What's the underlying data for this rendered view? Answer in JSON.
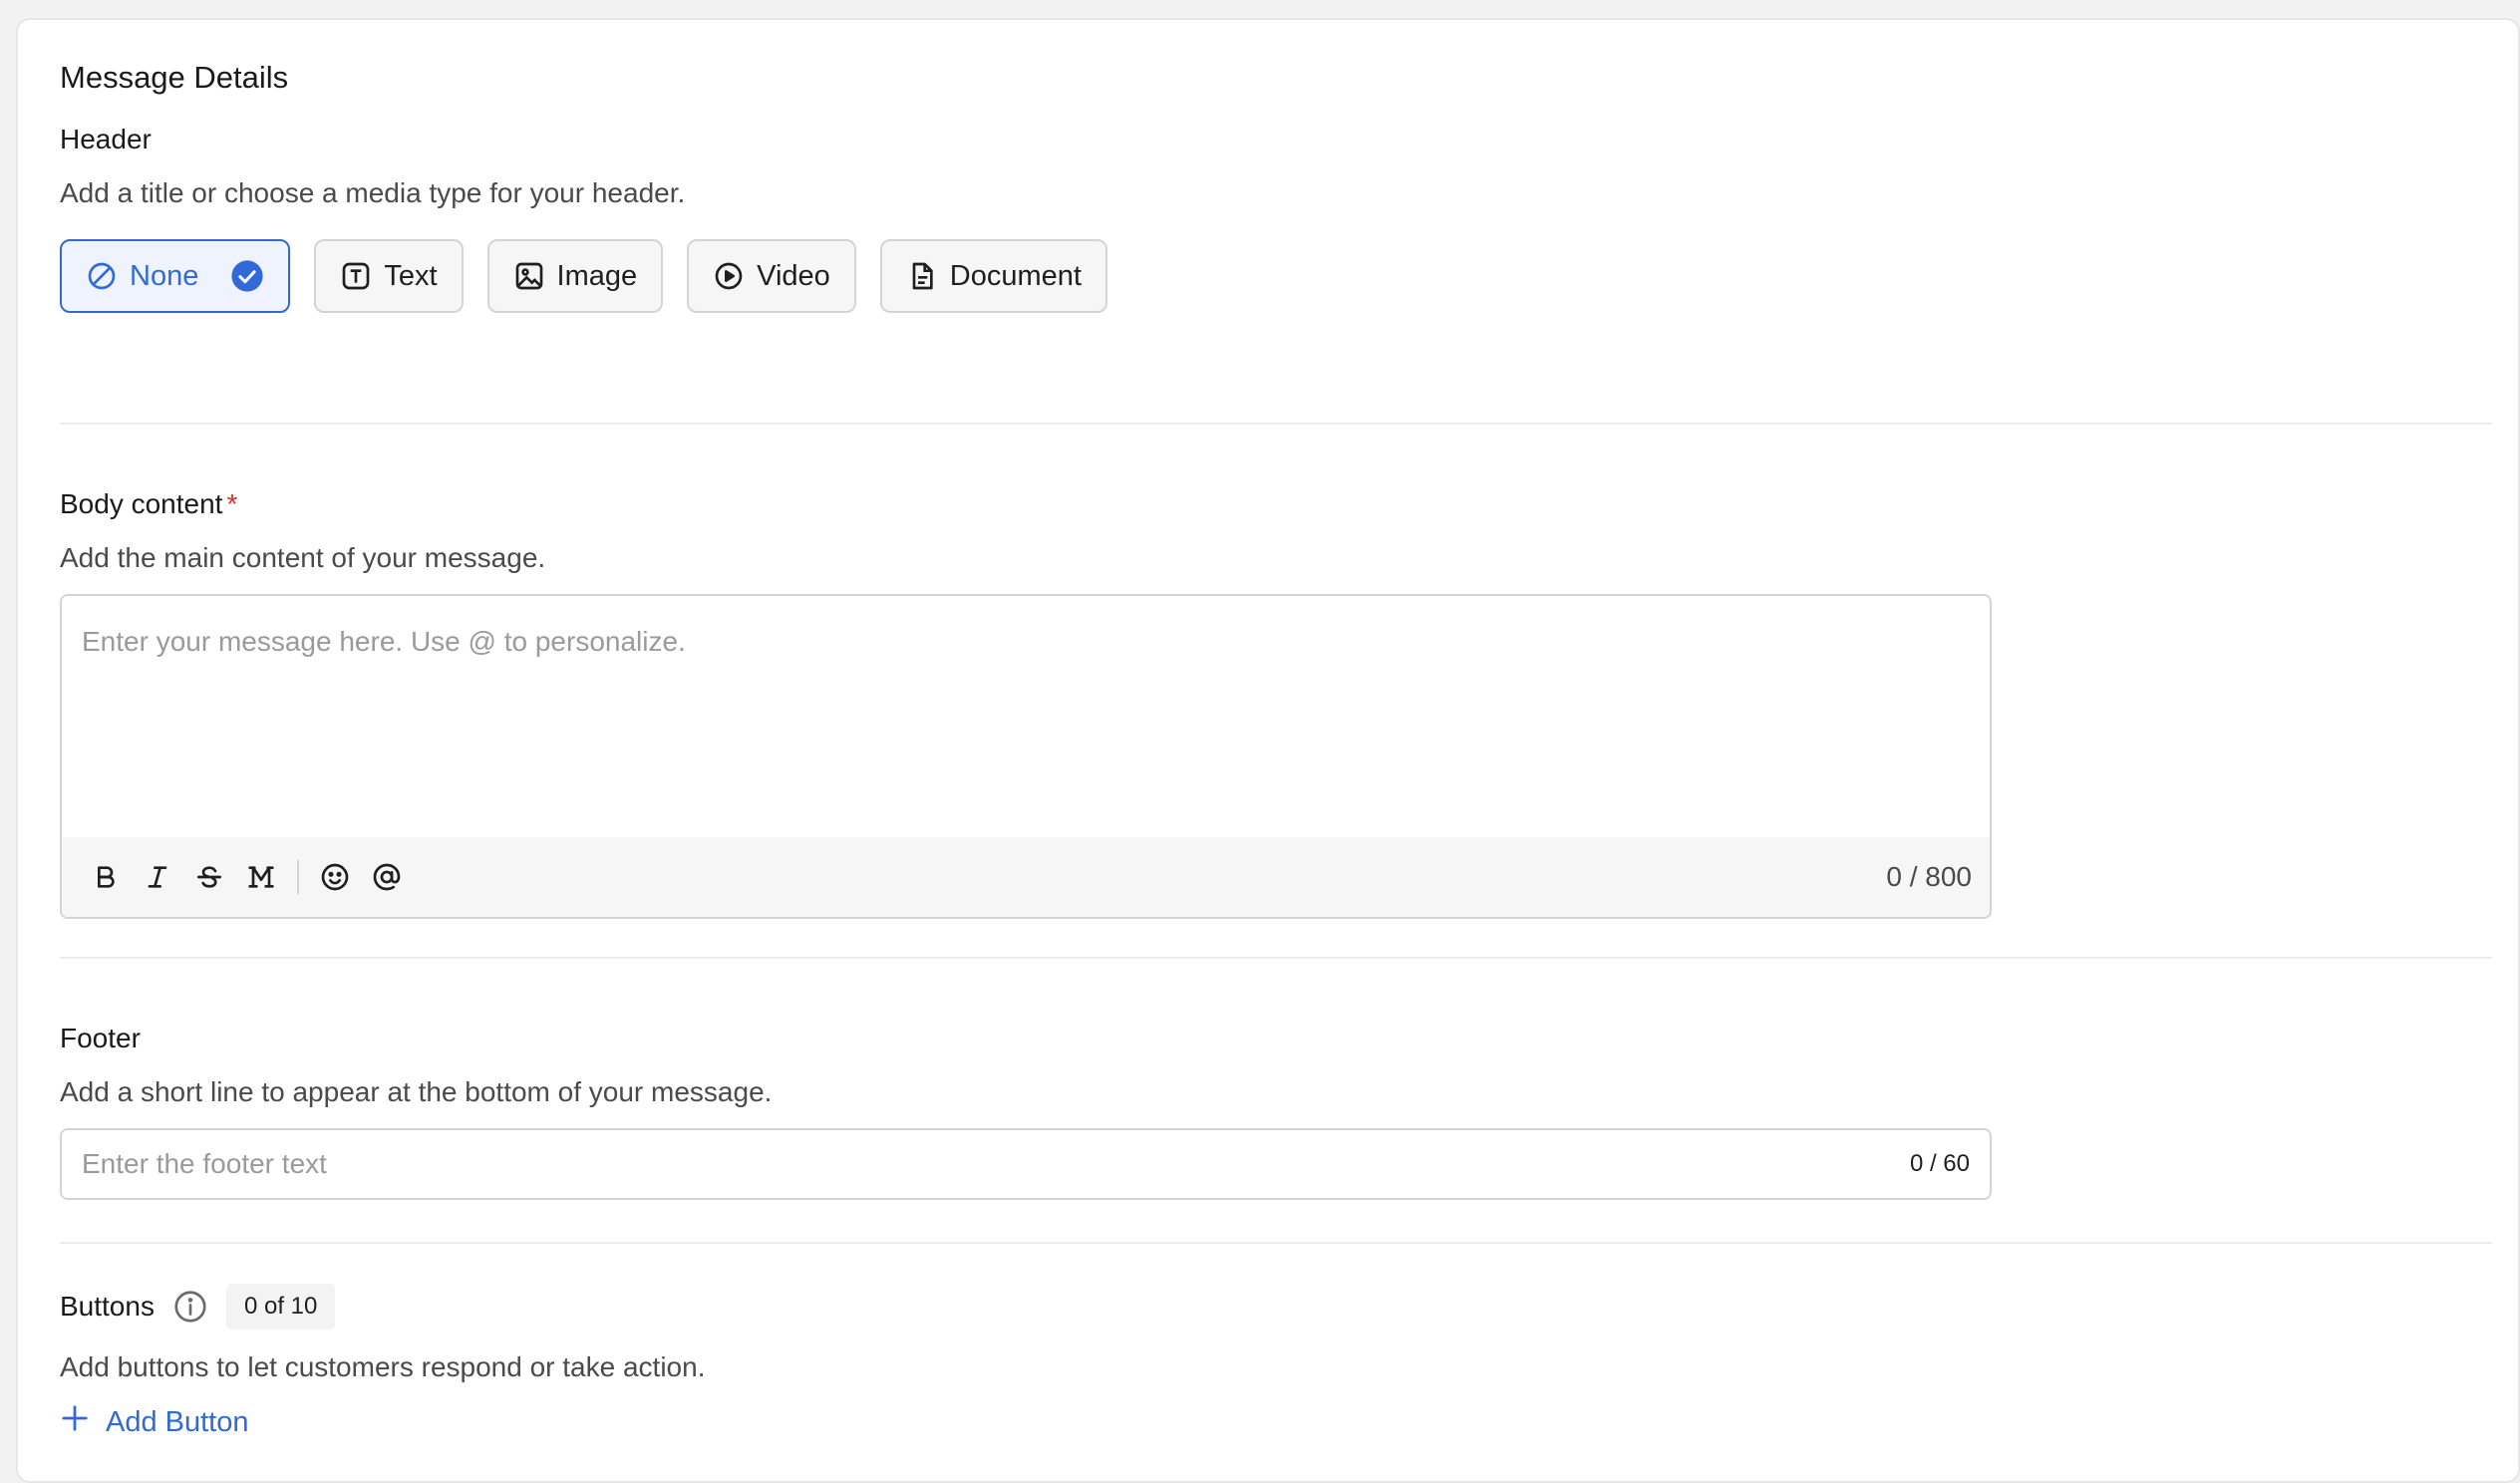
{
  "page": {
    "title": "Message Details"
  },
  "header": {
    "title": "Header",
    "description": "Add a title or choose a media type for your header.",
    "options": [
      {
        "label": "None",
        "icon": "ban-icon",
        "selected": true
      },
      {
        "label": "Text",
        "icon": "text-t-icon",
        "selected": false
      },
      {
        "label": "Image",
        "icon": "image-icon",
        "selected": false
      },
      {
        "label": "Video",
        "icon": "play-circle-icon",
        "selected": false
      },
      {
        "label": "Document",
        "icon": "document-icon",
        "selected": false
      }
    ]
  },
  "body": {
    "title": "Body content",
    "required_mark": "*",
    "description": "Add the main content of your message.",
    "placeholder": "Enter your message here. Use @ to personalize.",
    "value": "",
    "counter": "0 / 800",
    "toolbar": [
      "bold-icon",
      "italic-icon",
      "strikethrough-icon",
      "monospace-icon",
      "emoji-icon",
      "mention-icon"
    ]
  },
  "footer": {
    "title": "Footer",
    "description": "Add a short line to appear at the bottom of your message.",
    "placeholder": "Enter the footer text",
    "value": "",
    "counter": "0 / 60"
  },
  "buttons": {
    "title": "Buttons",
    "count_badge": "0 of 10",
    "description": "Add buttons to let customers respond or take action.",
    "add_label": "Add Button"
  },
  "colors": {
    "accent": "#2f6ad8",
    "required": "#d93025",
    "selected_bg": "#eef3fd"
  }
}
